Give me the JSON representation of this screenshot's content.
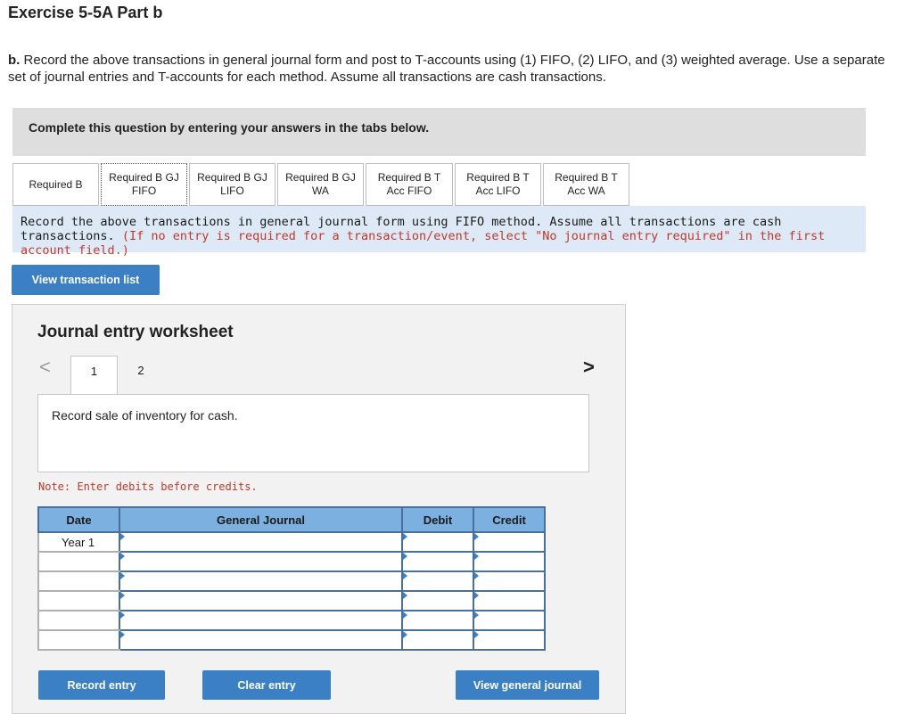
{
  "header": {
    "title": "Exercise 5-5A Part b",
    "prompt_bold": "b.",
    "prompt_text": "Record the above transactions in general journal form and post to T-accounts using (1) FIFO, (2) LIFO, and (3) weighted average. Use a separate set of journal entries and T-accounts for each method. Assume all transactions are cash transactions."
  },
  "banner": {
    "text": "Complete this question by entering your answers in the tabs below."
  },
  "tabs": [
    {
      "line1": "Required B",
      "line2": ""
    },
    {
      "line1": "Required B GJ",
      "line2": "FIFO"
    },
    {
      "line1": "Required B GJ",
      "line2": "LIFO"
    },
    {
      "line1": "Required B GJ",
      "line2": "WA"
    },
    {
      "line1": "Required B T",
      "line2": "Acc FIFO"
    },
    {
      "line1": "Required B T",
      "line2": "Acc LIFO"
    },
    {
      "line1": "Required B T",
      "line2": "Acc WA"
    }
  ],
  "instruction": {
    "text": "Record the above transactions in general journal form using FIFO method. Assume all transactions are cash transactions.",
    "red": "(If no entry is required for a transaction/event, select \"No journal entry required\" in the first account field.)"
  },
  "view_transaction_button": "View transaction list",
  "worksheet": {
    "title": "Journal entry worksheet",
    "pages": [
      "1",
      "2"
    ],
    "prev_arrow": "<",
    "next_arrow": ">",
    "description": "Record sale of inventory for cash.",
    "note": "Note: Enter debits before credits."
  },
  "journal": {
    "headers": {
      "date": "Date",
      "account": "General Journal",
      "debit": "Debit",
      "credit": "Credit"
    },
    "rows": [
      {
        "date": "Year 1"
      },
      {
        "date": ""
      },
      {
        "date": ""
      },
      {
        "date": ""
      },
      {
        "date": ""
      },
      {
        "date": ""
      }
    ]
  },
  "buttons": {
    "record": "Record entry",
    "clear": "Clear entry",
    "view_journal": "View general journal"
  },
  "colors": {
    "accent": "#3b7fc4",
    "note_red": "#c0392b",
    "instruction_bg": "#dde9f6",
    "header_blue": "#7bb0e0"
  }
}
